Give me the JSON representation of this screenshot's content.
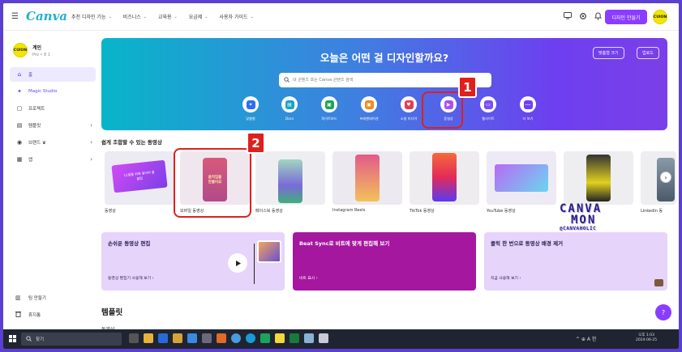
{
  "app": {
    "logo": "Canva"
  },
  "topnav": [
    {
      "label": "추천 디자인 기능",
      "caret": "⌄"
    },
    {
      "label": "비즈니스",
      "caret": "⌄"
    },
    {
      "label": "교육용",
      "caret": "⌄"
    },
    {
      "label": "요금제",
      "caret": "⌄"
    },
    {
      "label": "사용자 가이드",
      "caret": "⌄"
    }
  ],
  "header": {
    "design_button": "디자인 만들기",
    "avatar_text": "CUION"
  },
  "sidebar": {
    "profile_name": "계인",
    "profile_sub": "Pro • 8 1",
    "avatar_text": "CUION",
    "items": [
      {
        "label": "홈",
        "icon": "home-icon",
        "glyph": "⌂"
      },
      {
        "label": "Magic Studio",
        "icon": "magic-icon",
        "glyph": "✦"
      },
      {
        "label": "프로젝트",
        "icon": "folder-icon",
        "glyph": "▢"
      },
      {
        "label": "템플릿",
        "icon": "template-icon",
        "glyph": "▤",
        "chev": "›"
      },
      {
        "label": "브랜드 ♛",
        "icon": "brand-icon",
        "glyph": "◉",
        "chev": "›"
      },
      {
        "label": "앱",
        "icon": "apps-icon",
        "glyph": "▦",
        "chev": "›"
      }
    ],
    "bottom": [
      {
        "label": "팀 만들기",
        "icon": "team-icon",
        "glyph": "▥"
      },
      {
        "label": "휴지통",
        "icon": "trash-icon",
        "glyph": "🗑"
      }
    ]
  },
  "hero": {
    "title": "오늘은 어떤 걸 디자인할까요?",
    "btn_custom": "맞춤형 크기",
    "btn_upload": "업로드",
    "search_placeholder": "내 콘텐츠 또는 Canva 콘텐츠 검색",
    "categories": [
      {
        "label": "맞춤형",
        "color": "#2b6ef5",
        "glyph": "✦"
      },
      {
        "label": "Docs",
        "color": "#14a3c7",
        "glyph": "▤"
      },
      {
        "label": "화이트보드",
        "color": "#1aa35a",
        "glyph": "▣"
      },
      {
        "label": "프레젠테이션",
        "color": "#f08a1c",
        "glyph": "▣"
      },
      {
        "label": "소셜 미디어",
        "color": "#e73a50",
        "glyph": "♥"
      },
      {
        "label": "동영상",
        "color": "#b14cf0",
        "glyph": "▶"
      },
      {
        "label": "웹사이트",
        "color": "#7a4df5",
        "glyph": "▭"
      },
      {
        "label": "더 보기",
        "color": "#6d3ff0",
        "glyph": "•••"
      }
    ]
  },
  "annotations": {
    "badge1": "1",
    "badge2": "2"
  },
  "videos": {
    "section_title": "쉽게 조합할 수 있는 동영상",
    "items": [
      {
        "label": "동영상",
        "thumb": "11월을 위해 알아야 할 꿀팁"
      },
      {
        "label": "모바일 동영상",
        "thumb": "움직임을 만들어요"
      },
      {
        "label": "페이스북 동영상",
        "thumb": ""
      },
      {
        "label": "Instagram Reels",
        "thumb": ""
      },
      {
        "label": "TikTok 동영상",
        "thumb": ""
      },
      {
        "label": "YouTube 동영상",
        "thumb": ""
      },
      {
        "label": "",
        "thumb": ""
      },
      {
        "label": "LinkedIn 동",
        "thumb": ""
      }
    ],
    "next": "›"
  },
  "features": [
    {
      "title": "손쉬운 동영상 편집",
      "link": "동영상 편집기 사용해 보기 ›"
    },
    {
      "title": "Beat Sync로 비트에 맞게 편집해 보기",
      "link": "비트 표시 ›"
    },
    {
      "title": "클릭 한 번으로 동영상 배경 제거",
      "link": "지금 사용해 보기 ›"
    }
  ],
  "templates": {
    "title": "템플릿",
    "sub": "동영상"
  },
  "help": "?",
  "watermark": {
    "line1": "CANVA",
    "line2": "MON",
    "line3": "@CANVAHOLIC"
  },
  "taskbar": {
    "search_label": "찾기",
    "clock_time": "오후 1:03",
    "clock_date": "2024-06-25",
    "tray": "^ ⊕ A 한"
  }
}
